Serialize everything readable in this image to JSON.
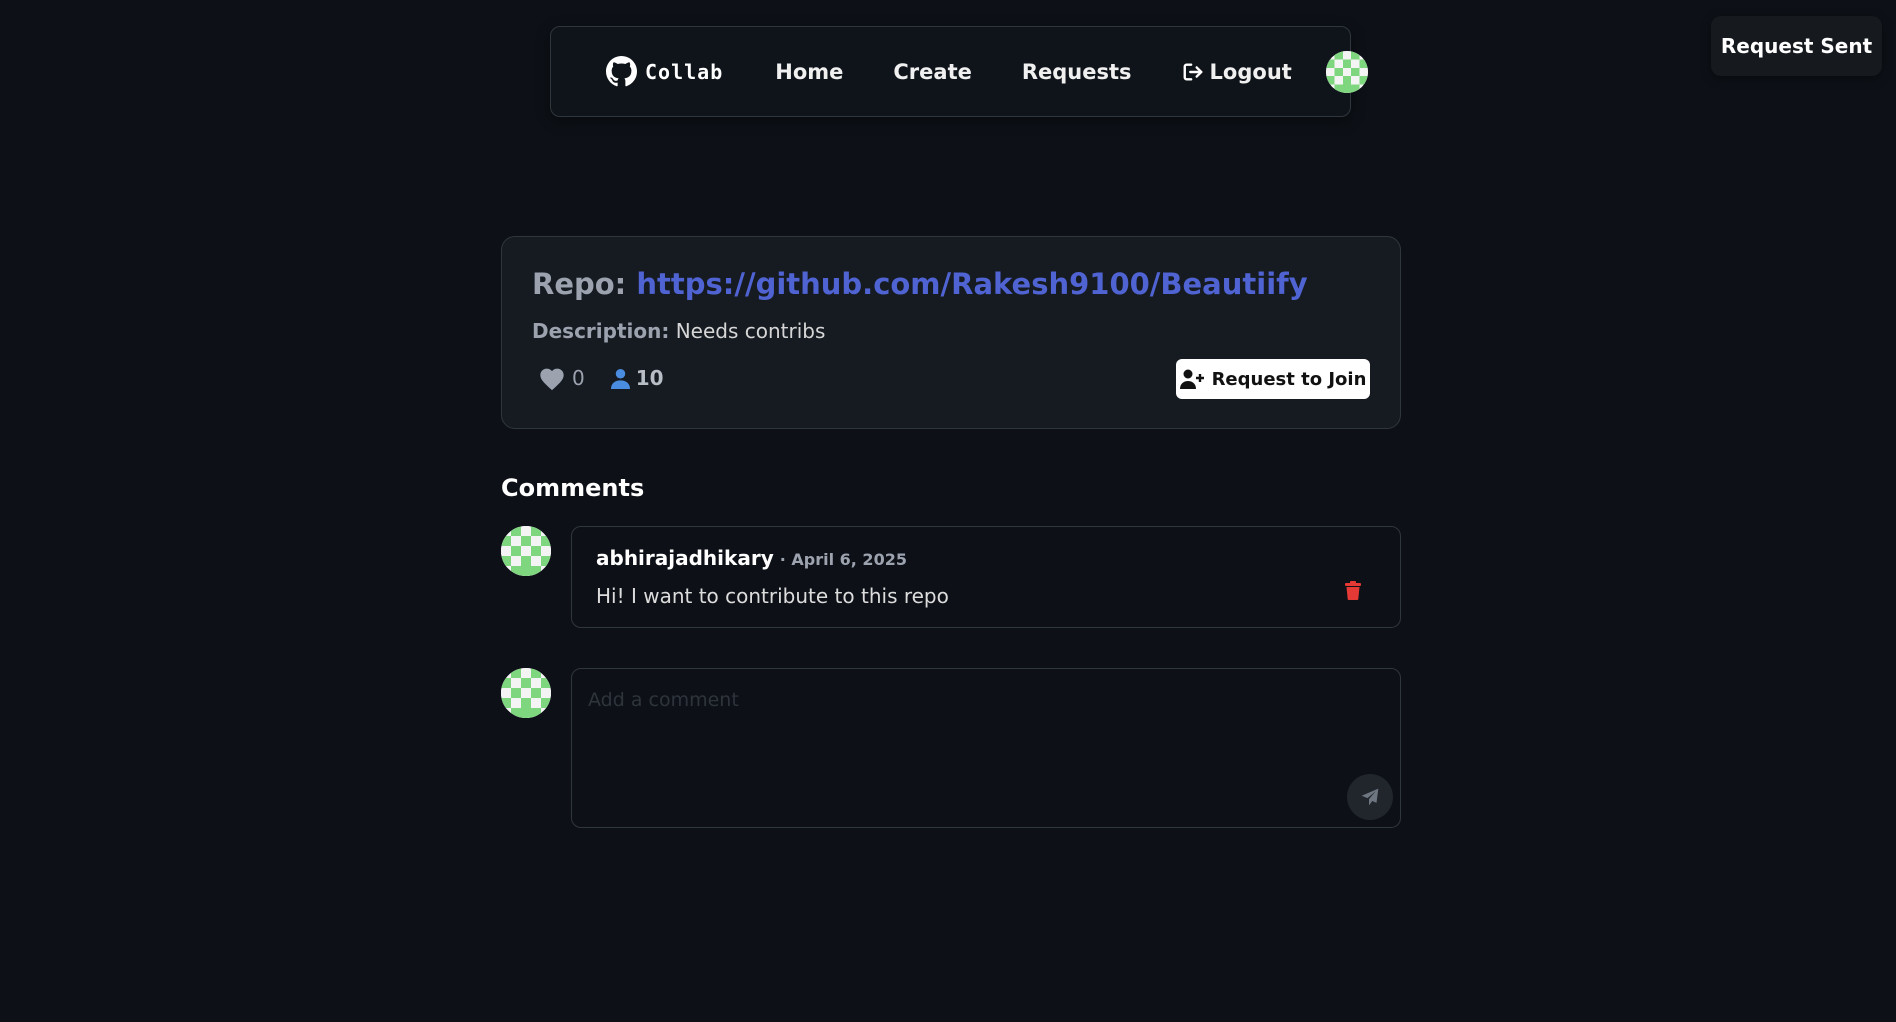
{
  "navbar": {
    "brand_text": "Collab",
    "links": {
      "home": "Home",
      "create": "Create",
      "requests": "Requests",
      "logout": "Logout"
    },
    "icons": {
      "brand": "github-icon",
      "logout": "logout-icon",
      "profile": "avatar"
    }
  },
  "toast": {
    "message": "Request Sent"
  },
  "repo": {
    "title_label": "Repo:",
    "url": "https://github.com/Rakesh9100/Beautiify",
    "description_label": "Description:",
    "description": "Needs contribs",
    "likes": "0",
    "members": "10",
    "join_button_label": "Request to Join",
    "icons": {
      "likes": "heart-icon",
      "members": "user-icon",
      "join": "user-plus-icon"
    }
  },
  "comments": {
    "heading": "Comments",
    "items": [
      {
        "author": "abhirajadhikary",
        "date": "· April 6, 2025",
        "text": "Hi! I want to contribute to this repo"
      }
    ],
    "composer_placeholder": "Add a comment",
    "icons": {
      "delete": "trash-icon",
      "send": "paper-plane-icon"
    }
  },
  "colors": {
    "background": "#0d1117",
    "card": "#161b22",
    "link": "#4f63d2",
    "avatar_green": "#7ed67e",
    "member_icon": "#4a8de0",
    "delete": "#e53935"
  }
}
